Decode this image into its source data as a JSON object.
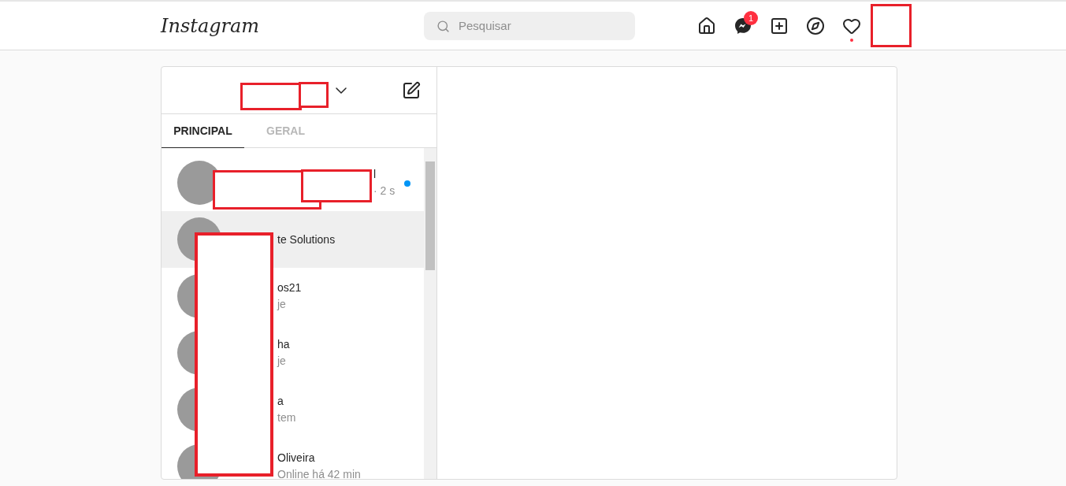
{
  "header": {
    "logo": "Instagram",
    "search": {
      "placeholder": "Pesquisar"
    },
    "nav": [
      {
        "kind": "home"
      },
      {
        "kind": "messenger",
        "badge": "1"
      },
      {
        "kind": "new-post"
      },
      {
        "kind": "explore"
      },
      {
        "kind": "activity",
        "dot": true
      }
    ]
  },
  "inbox": {
    "tabs": [
      {
        "label": "PRINCIPAL",
        "selected": true
      },
      {
        "label": "GERAL",
        "selected": false
      }
    ],
    "conversations": [
      {
        "name": "l",
        "preview": "· 2 s",
        "unread": true,
        "selected": false
      },
      {
        "name": "te Solutions",
        "unread": false,
        "selected": true
      },
      {
        "name": "os21",
        "preview": "je",
        "unread": false,
        "selected": false
      },
      {
        "name": "ha",
        "preview": "je",
        "unread": false,
        "selected": false
      },
      {
        "name": "a",
        "preview": "tem",
        "unread": false,
        "selected": false
      },
      {
        "name": "Oliveira",
        "preview": "Online há 42 min",
        "unread": false,
        "selected": false
      }
    ]
  }
}
